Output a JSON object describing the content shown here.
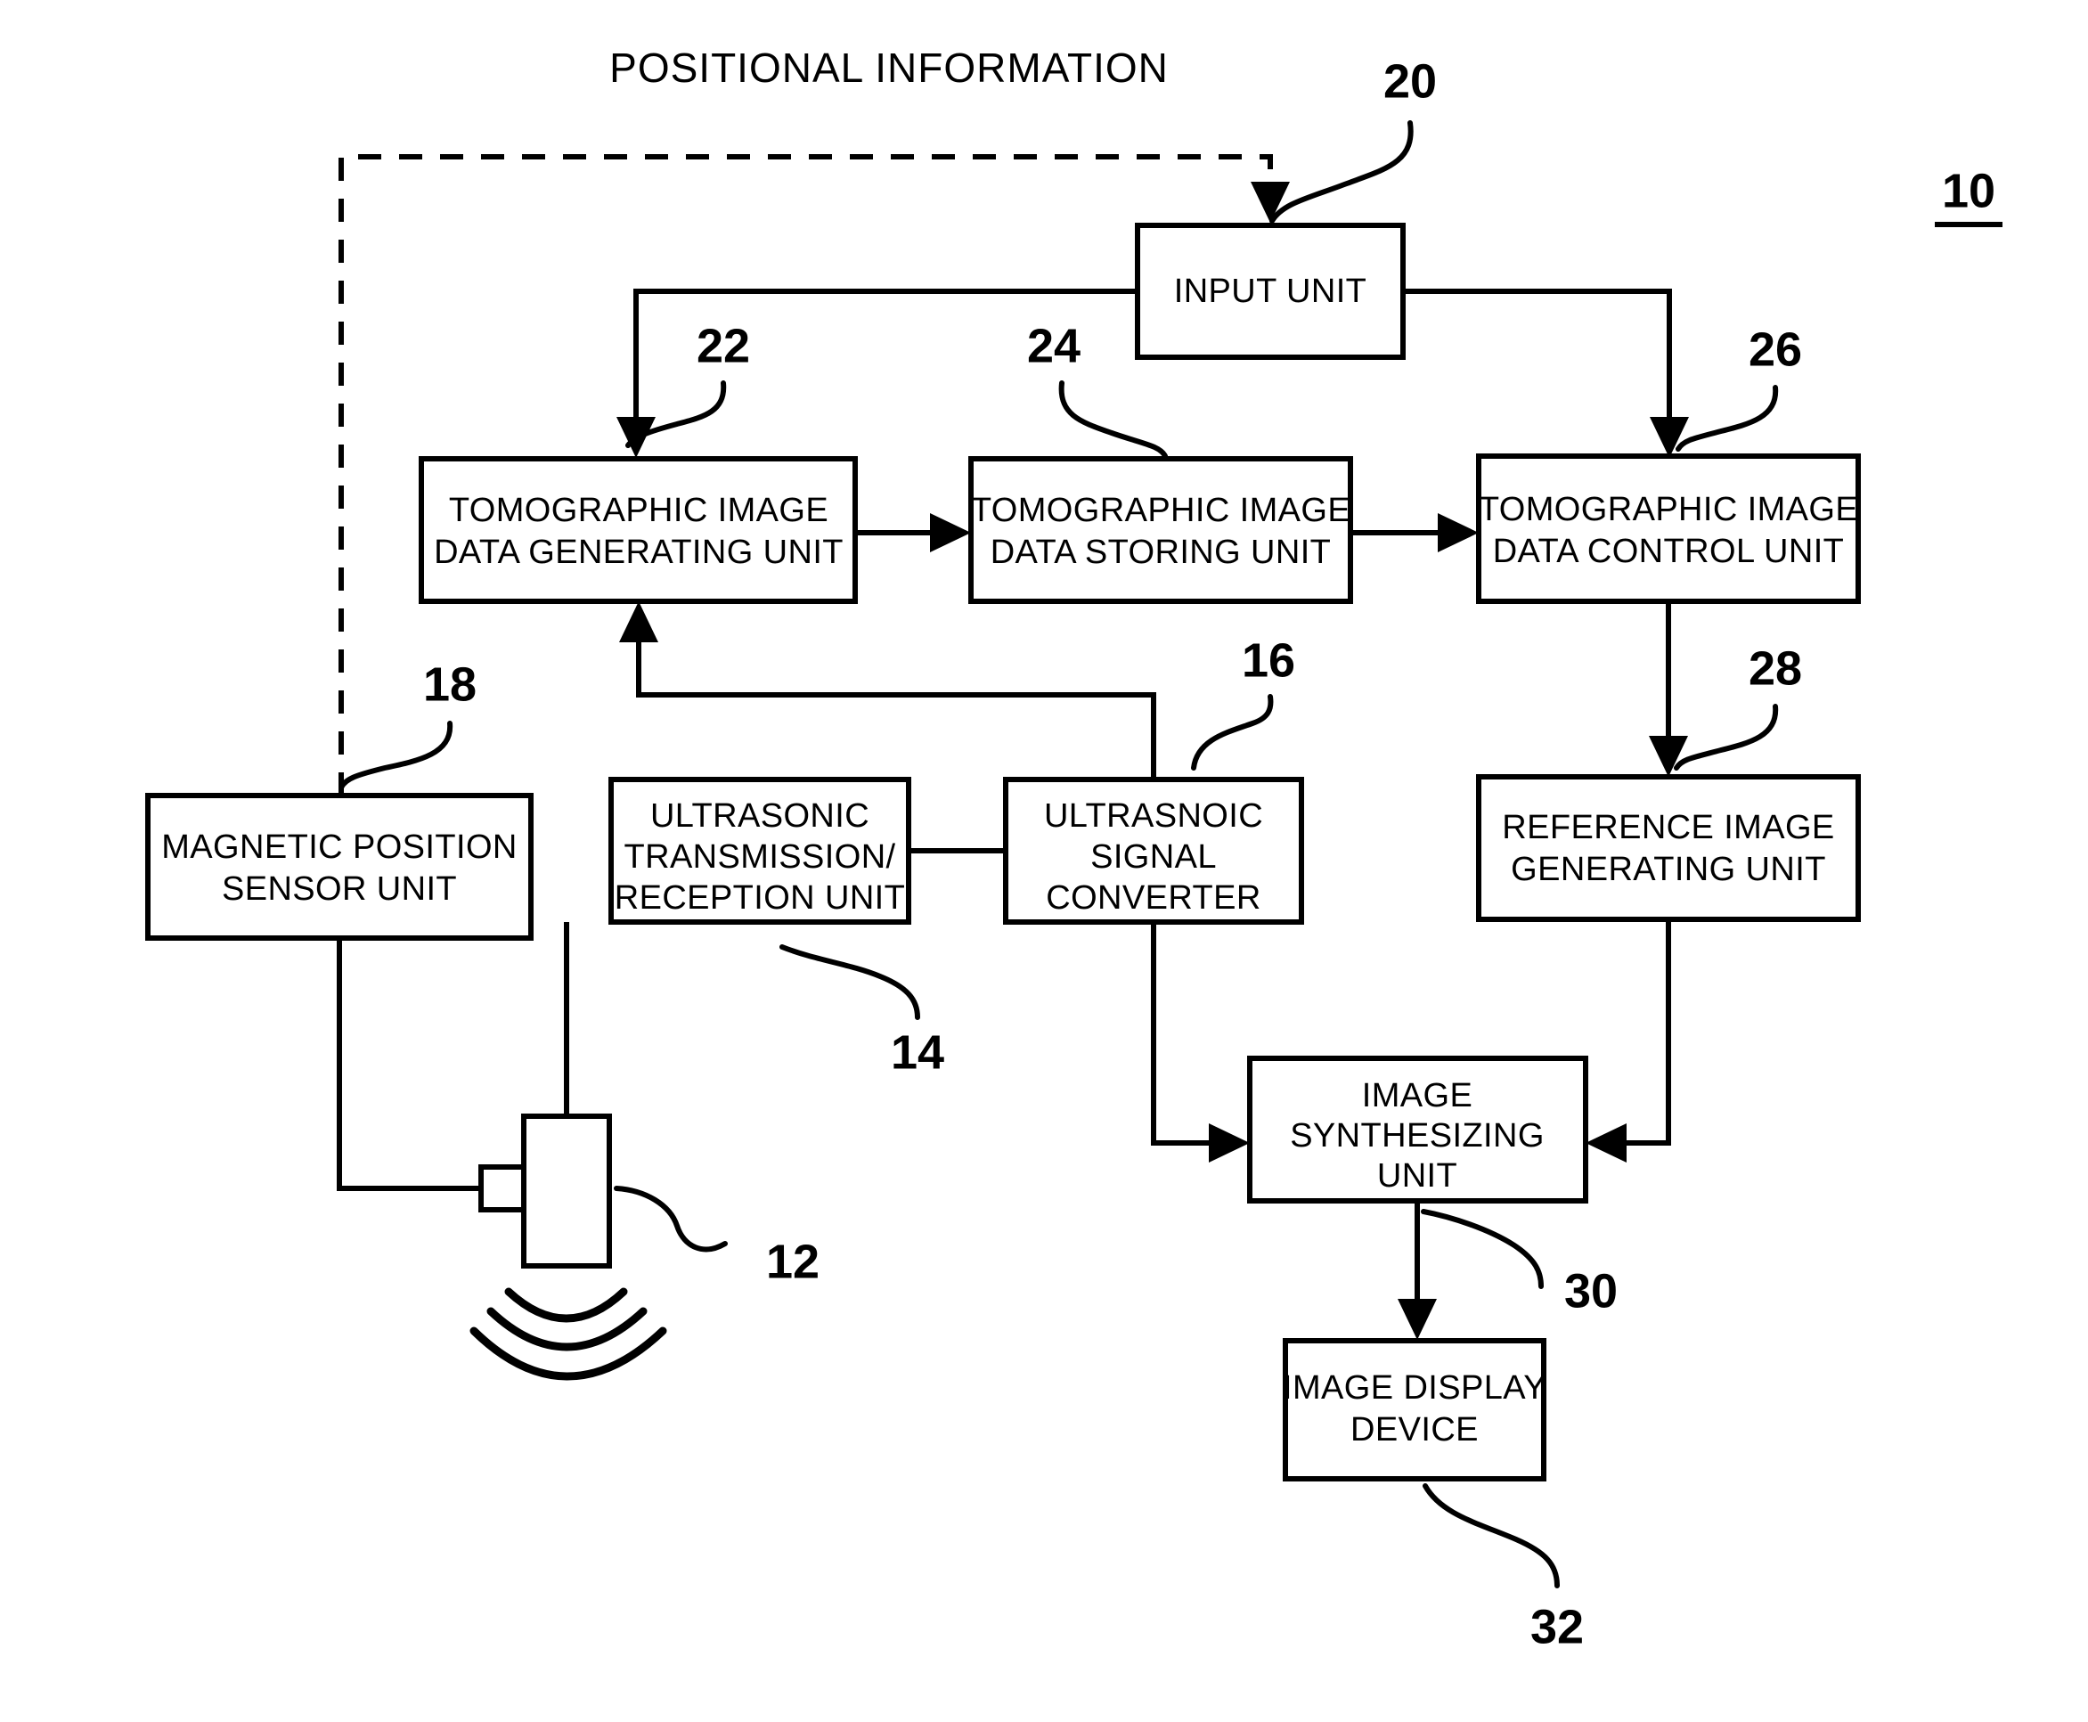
{
  "figure": {
    "title": "POSITIONAL INFORMATION",
    "assembly_ref": "10"
  },
  "blocks": {
    "input_unit": {
      "lines": [
        "INPUT UNIT"
      ],
      "ref": "20"
    },
    "tomographic_generating": {
      "lines": [
        "TOMOGRAPHIC IMAGE",
        "DATA GENERATING UNIT"
      ],
      "ref": "22"
    },
    "tomographic_storing": {
      "lines": [
        "TOMOGRAPHIC IMAGE",
        "DATA STORING UNIT"
      ],
      "ref": "24"
    },
    "tomographic_control": {
      "lines": [
        "TOMOGRAPHIC IMAGE",
        "DATA CONTROL UNIT"
      ],
      "ref": "26"
    },
    "magnetic_position_sensor": {
      "lines": [
        "MAGNETIC POSITION",
        "SENSOR UNIT"
      ],
      "ref": "18"
    },
    "ultrasonic_transmission_reception": {
      "lines": [
        "ULTRASONIC",
        "TRANSMISSION/",
        "RECEPTION UNIT"
      ],
      "ref": "14"
    },
    "ultrasonic_signal_converter": {
      "lines": [
        "ULTRASNOIC",
        "SIGNAL",
        "CONVERTER"
      ],
      "ref": "16"
    },
    "reference_image_generating": {
      "lines": [
        "REFERENCE IMAGE",
        "GENERATING UNIT"
      ],
      "ref": "28"
    },
    "image_synthesizing": {
      "lines": [
        "IMAGE",
        "SYNTHESIZING",
        "UNIT"
      ],
      "ref": "30"
    },
    "image_display_device": {
      "lines": [
        "IMAGE DISPLAY",
        "DEVICE"
      ],
      "ref": "32"
    },
    "ultrasonic_probe": {
      "lines": [],
      "ref": "12"
    }
  },
  "ref_numbers": {
    "n10": "10",
    "n12": "12",
    "n14": "14",
    "n16": "16",
    "n18": "18",
    "n20": "20",
    "n22": "22",
    "n24": "24",
    "n26": "26",
    "n28": "28",
    "n30": "30",
    "n32": "32"
  },
  "block_text": {
    "input_unit_l1": "INPUT UNIT",
    "tg_l1": "TOMOGRAPHIC IMAGE",
    "tg_l2": "DATA GENERATING UNIT",
    "ts_l1": "TOMOGRAPHIC IMAGE",
    "ts_l2": "DATA STORING UNIT",
    "tc_l1": "TOMOGRAPHIC IMAGE",
    "tc_l2": "DATA CONTROL UNIT",
    "mps_l1": "MAGNETIC POSITION",
    "mps_l2": "SENSOR UNIT",
    "utr_l1": "ULTRASONIC",
    "utr_l2": "TRANSMISSION/",
    "utr_l3": "RECEPTION UNIT",
    "usc_l1": "ULTRASNOIC",
    "usc_l2": "SIGNAL",
    "usc_l3": "CONVERTER",
    "rig_l1": "REFERENCE IMAGE",
    "rig_l2": "GENERATING UNIT",
    "isu_l1": "IMAGE",
    "isu_l2": "SYNTHESIZING",
    "isu_l3": "UNIT",
    "idd_l1": "IMAGE DISPLAY",
    "idd_l2": "DEVICE"
  },
  "colors": {
    "ink": "#000000",
    "paper": "#ffffff"
  }
}
